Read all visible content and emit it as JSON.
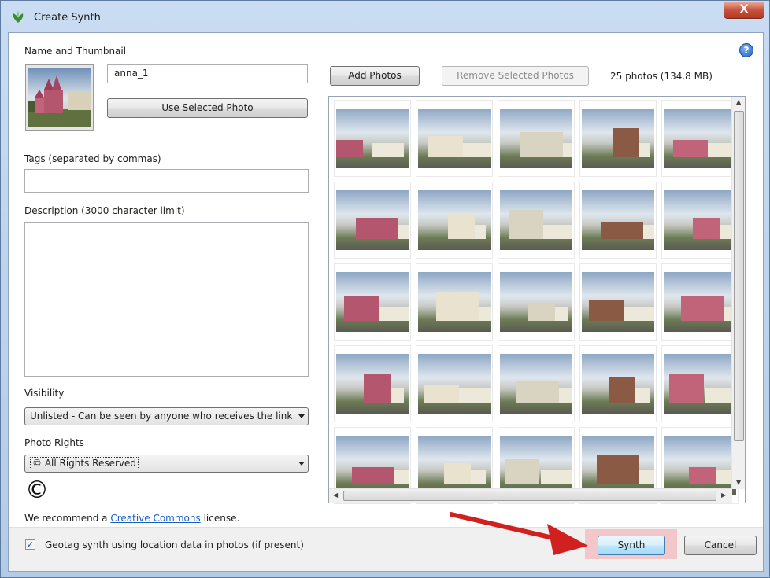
{
  "window": {
    "title": "Create Synth",
    "close_label": "X"
  },
  "sections": {
    "name_thumbnail": "Name and Thumbnail",
    "tags": "Tags (separated by commas)",
    "description": "Description (3000 character limit)",
    "visibility": "Visibility",
    "photo_rights": "Photo Rights"
  },
  "fields": {
    "name_value": "anna_1",
    "tags_value": "",
    "description_value": ""
  },
  "buttons": {
    "use_selected_photo": "Use Selected Photo",
    "add_photos": "Add Photos",
    "remove_selected_photos": "Remove Selected Photos",
    "synth": "Synth",
    "cancel": "Cancel"
  },
  "photos": {
    "count_label": "25 photos (134.8 MB)",
    "total": 25
  },
  "visibility": {
    "selected": "Unlisted - Can be seen by anyone who receives the link"
  },
  "rights": {
    "selected": "© All Rights Reserved",
    "symbol": "©"
  },
  "license": {
    "prefix": "We recommend a ",
    "link": "Creative Commons",
    "suffix": " license."
  },
  "geotag": {
    "label": "Geotag synth using location data in photos (if present)",
    "checked": true
  },
  "help_label": "?",
  "colors": {
    "accent": "#2162c4",
    "highlight": "#f3c6c9",
    "arrow": "#d12020"
  }
}
